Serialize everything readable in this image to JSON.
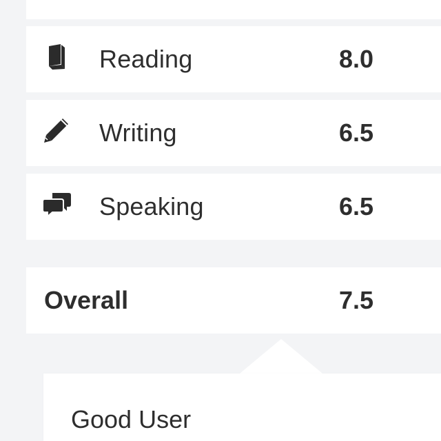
{
  "scores": [
    {
      "icon": "book-icon",
      "label": "Reading",
      "score": "8.0"
    },
    {
      "icon": "pencil-icon",
      "label": "Writing",
      "score": "6.5"
    },
    {
      "icon": "speech-bubbles-icon",
      "label": "Speaking",
      "score": "6.5"
    }
  ],
  "overall": {
    "label": "Overall",
    "score": "7.5"
  },
  "band": {
    "description": "Good User"
  },
  "colors": {
    "background": "#f3f4f6",
    "card": "#ffffff",
    "text": "#2e2e2e"
  }
}
